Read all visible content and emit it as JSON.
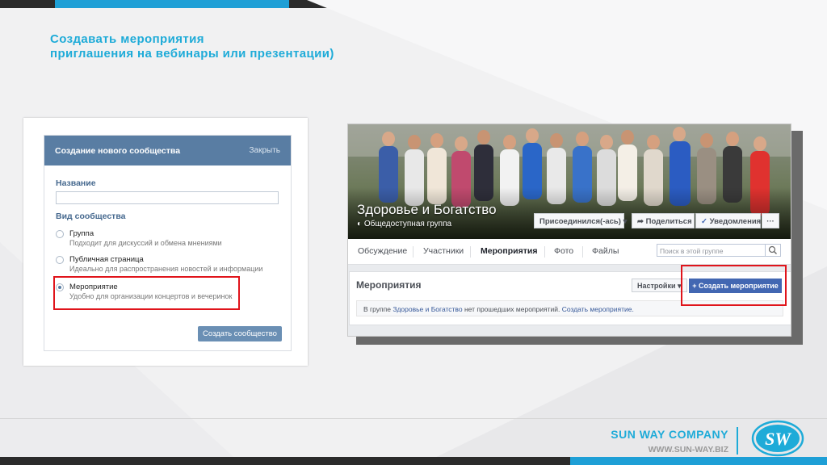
{
  "slide": {
    "title_line1": "Создавать мероприятия",
    "title_line2": "приглашения на вебинары или презентации)"
  },
  "vk_dialog": {
    "header": "Создание нового сообщества",
    "close": "Закрыть",
    "name_label": "Название",
    "name_value": "",
    "type_label": "Вид сообщества",
    "options": [
      {
        "title": "Группа",
        "desc": "Подходит для дискуссий и обмена мнениями",
        "selected": false
      },
      {
        "title": "Публичная страница",
        "desc": "Идеально для распространения новостей и информации",
        "selected": false
      },
      {
        "title": "Мероприятие",
        "desc": "Удобно для организации концертов и вечеринок",
        "selected": true
      }
    ],
    "submit": "Создать сообщество"
  },
  "fb": {
    "group_name": "Здоровье и Богатство",
    "group_type": "Общедоступная группа",
    "joined": "Присоединился(-ась)",
    "share": "Поделиться",
    "notifications": "Уведомления",
    "more": "···",
    "tabs": [
      "Обсуждение",
      "Участники",
      "Мероприятия",
      "Фото",
      "Файлы"
    ],
    "active_tab": "Мероприятия",
    "search_placeholder": "Поиск в этой группе",
    "events_title": "Мероприятия",
    "settings": "Настройки",
    "create_event": "+ Создать мероприятие",
    "note_prefix": "В группе ",
    "note_group": "Здоровье и Богатство",
    "note_middle": " нет прошедших мероприятий. ",
    "note_link": "Создать мероприятие."
  },
  "footer": {
    "company": "SUN WAY COMPANY",
    "website": "WWW.SUN-WAY.BIZ",
    "logo_text": "SW"
  },
  "colors": {
    "accent": "#1eabd8",
    "dark_bar": "#2b2b2b",
    "vk_header": "#597da3",
    "fb_blue": "#4267b2",
    "highlight": "#e0141b"
  }
}
